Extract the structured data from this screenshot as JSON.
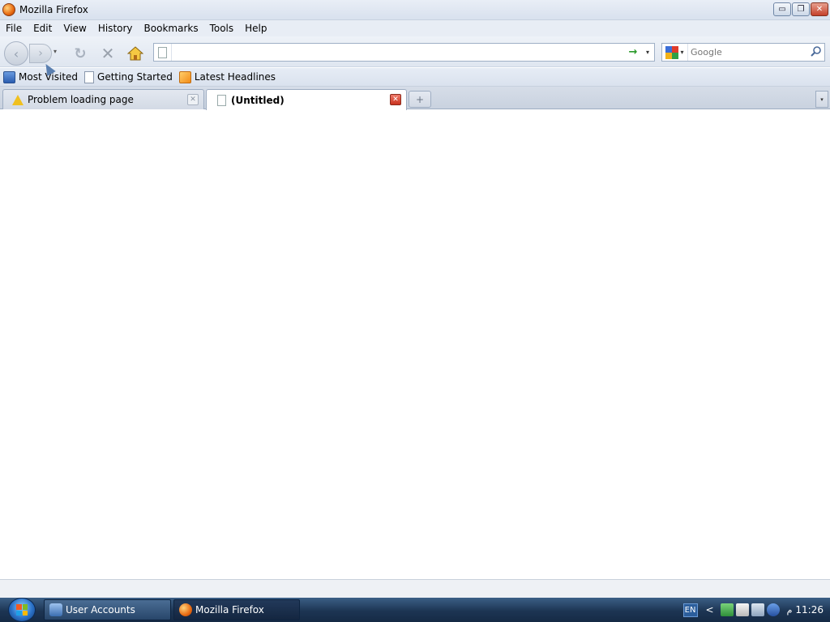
{
  "window": {
    "title": "Mozilla Firefox",
    "buttons": {
      "minimize": "▭",
      "maximize": "❐",
      "close": "✕"
    }
  },
  "menu": {
    "items": [
      "File",
      "Edit",
      "View",
      "History",
      "Bookmarks",
      "Tools",
      "Help"
    ]
  },
  "nav": {
    "back_icon": "‹",
    "forward_icon": "›",
    "dropdown": "▾",
    "reload_icon": "↻",
    "stop_icon": "✕",
    "url_value": "",
    "go_icon": "→",
    "url_dropdown": "▾",
    "search_engine_dropdown": "▾",
    "search_placeholder": "Google",
    "search_icon": "🔍"
  },
  "bookmarks": {
    "items": [
      "Most Visited",
      "Getting Started",
      "Latest Headlines"
    ]
  },
  "tabs": {
    "items": [
      {
        "label": "Problem loading page",
        "active": false
      },
      {
        "label": "(Untitled)",
        "active": true
      }
    ],
    "close_icon": "✕",
    "new_tab_icon": "+",
    "list_icon": "▾"
  },
  "taskbar": {
    "buttons": [
      "User Accounts",
      "Mozilla Firefox"
    ],
    "language": "EN",
    "tray_arrow": "<",
    "clock_prefix": "م",
    "clock": "11:26"
  },
  "colors": {
    "titlebar": "#e9eef6",
    "taskbar": "#1d3553",
    "close_red": "#c4402a"
  }
}
